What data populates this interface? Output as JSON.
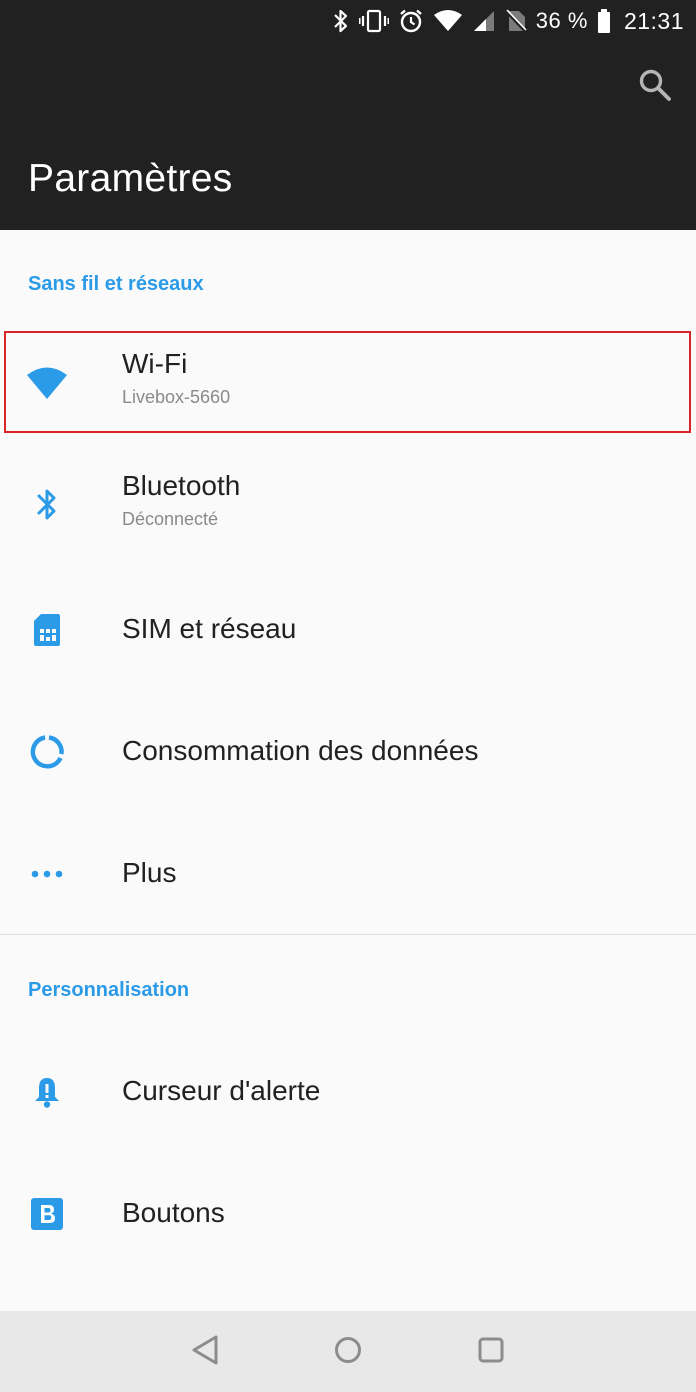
{
  "status_bar": {
    "battery": "36 %",
    "time": "21:31",
    "icons": [
      "bluetooth-icon",
      "vibrate-icon",
      "alarm-icon",
      "wifi-icon",
      "signal-icon",
      "no-sim-icon",
      "battery-icon"
    ]
  },
  "app_bar": {
    "title": "Paramètres",
    "search_icon": "search-icon"
  },
  "sections": [
    {
      "header": "Sans fil et réseaux",
      "items": [
        {
          "title": "Wi-Fi",
          "subtitle": "Livebox-5660",
          "icon": "wifi-icon"
        },
        {
          "title": "Bluetooth",
          "subtitle": "Déconnecté",
          "icon": "bluetooth-icon"
        },
        {
          "title": "SIM et réseau",
          "icon": "sim-card-icon"
        },
        {
          "title": "Consommation des données",
          "icon": "data-usage-icon"
        },
        {
          "title": "Plus",
          "icon": "more-icon"
        }
      ]
    },
    {
      "header": "Personnalisation",
      "items": [
        {
          "title": "Curseur d'alerte",
          "icon": "alert-bell-icon"
        },
        {
          "title": "Boutons",
          "icon": "buttons-b-icon"
        }
      ]
    }
  ],
  "nav_bar": {
    "icons": [
      "back-icon",
      "home-icon",
      "recents-icon"
    ]
  },
  "colors": {
    "accent": "#2b9be8",
    "app_bar": "#212121",
    "highlight": "#d8232a",
    "background": "#fafafa"
  }
}
